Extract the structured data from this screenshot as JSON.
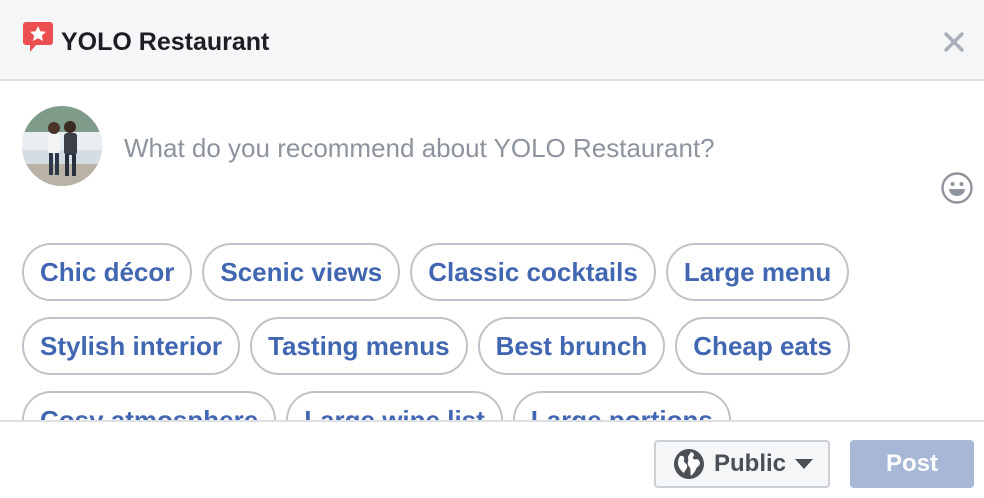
{
  "header": {
    "title": "YOLO Restaurant",
    "badge_icon": "recommendation-star-icon",
    "close_icon": "close-icon"
  },
  "composer": {
    "avatar_icon": "user-avatar",
    "placeholder": "What do you recommend about YOLO Restaurant?",
    "value": "",
    "emoji_icon": "smiley-face-icon"
  },
  "suggestions": {
    "items": [
      "Chic décor",
      "Scenic views",
      "Classic cocktails",
      "Large menu",
      "Stylish interior",
      "Tasting menus",
      "Best brunch",
      "Cheap eats",
      "Cosy atmosphere",
      "Large wine list",
      "Large portions"
    ]
  },
  "footer": {
    "audience_label": "Public",
    "audience_icon": "globe-icon",
    "caret_icon": "caret-down-icon",
    "post_label": "Post"
  },
  "colors": {
    "brand_blue": "#4267b2",
    "post_disabled": "#a7b7d6",
    "badge_red": "#ec4f4f",
    "header_bg": "#f5f6f7"
  }
}
